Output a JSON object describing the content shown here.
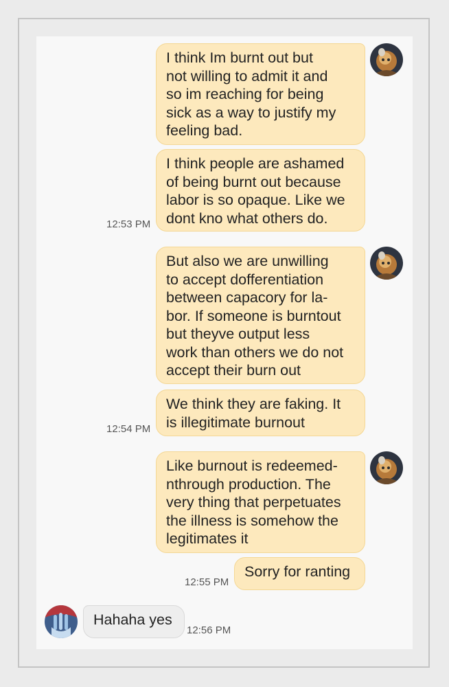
{
  "conversation": {
    "messages": [
      {
        "text": "I think Im burnt out but\nnot willing to admit it and\nso im reaching for being\nsick as a way to justify my\nfeeling bad."
      },
      {
        "text": "I think people are ashamed\nof being burnt out because\nlabor is so opaque. Like we\ndont kno what others do.",
        "time": "12:53 PM"
      },
      {
        "text": "But also we are unwilling\nto accept dofferentiation\nbetween capacory for la-\nbor. If someone is burntout\nbut theyve output less\nwork than others we do not\naccept their burn out"
      },
      {
        "text": "We think they are faking. It\nis illegitimate burnout",
        "time": "12:54 PM"
      },
      {
        "text": "Like burnout is redeemed-\nnthrough production. The\nvery thing that perpetuates\nthe illness is somehow the\nlegitimates it"
      },
      {
        "text": "Sorry for ranting",
        "time": "12:55 PM"
      },
      {
        "text": "Hahaha yes",
        "time": "12:56 PM"
      }
    ]
  },
  "colors": {
    "sent_bubble": "#fde9bd",
    "received_bubble": "#eeeeee",
    "chat_background": "#f8f8f8"
  },
  "avatars": {
    "me": "contact-avatar-orange-figure",
    "them": "contact-avatar-blue-figure"
  }
}
